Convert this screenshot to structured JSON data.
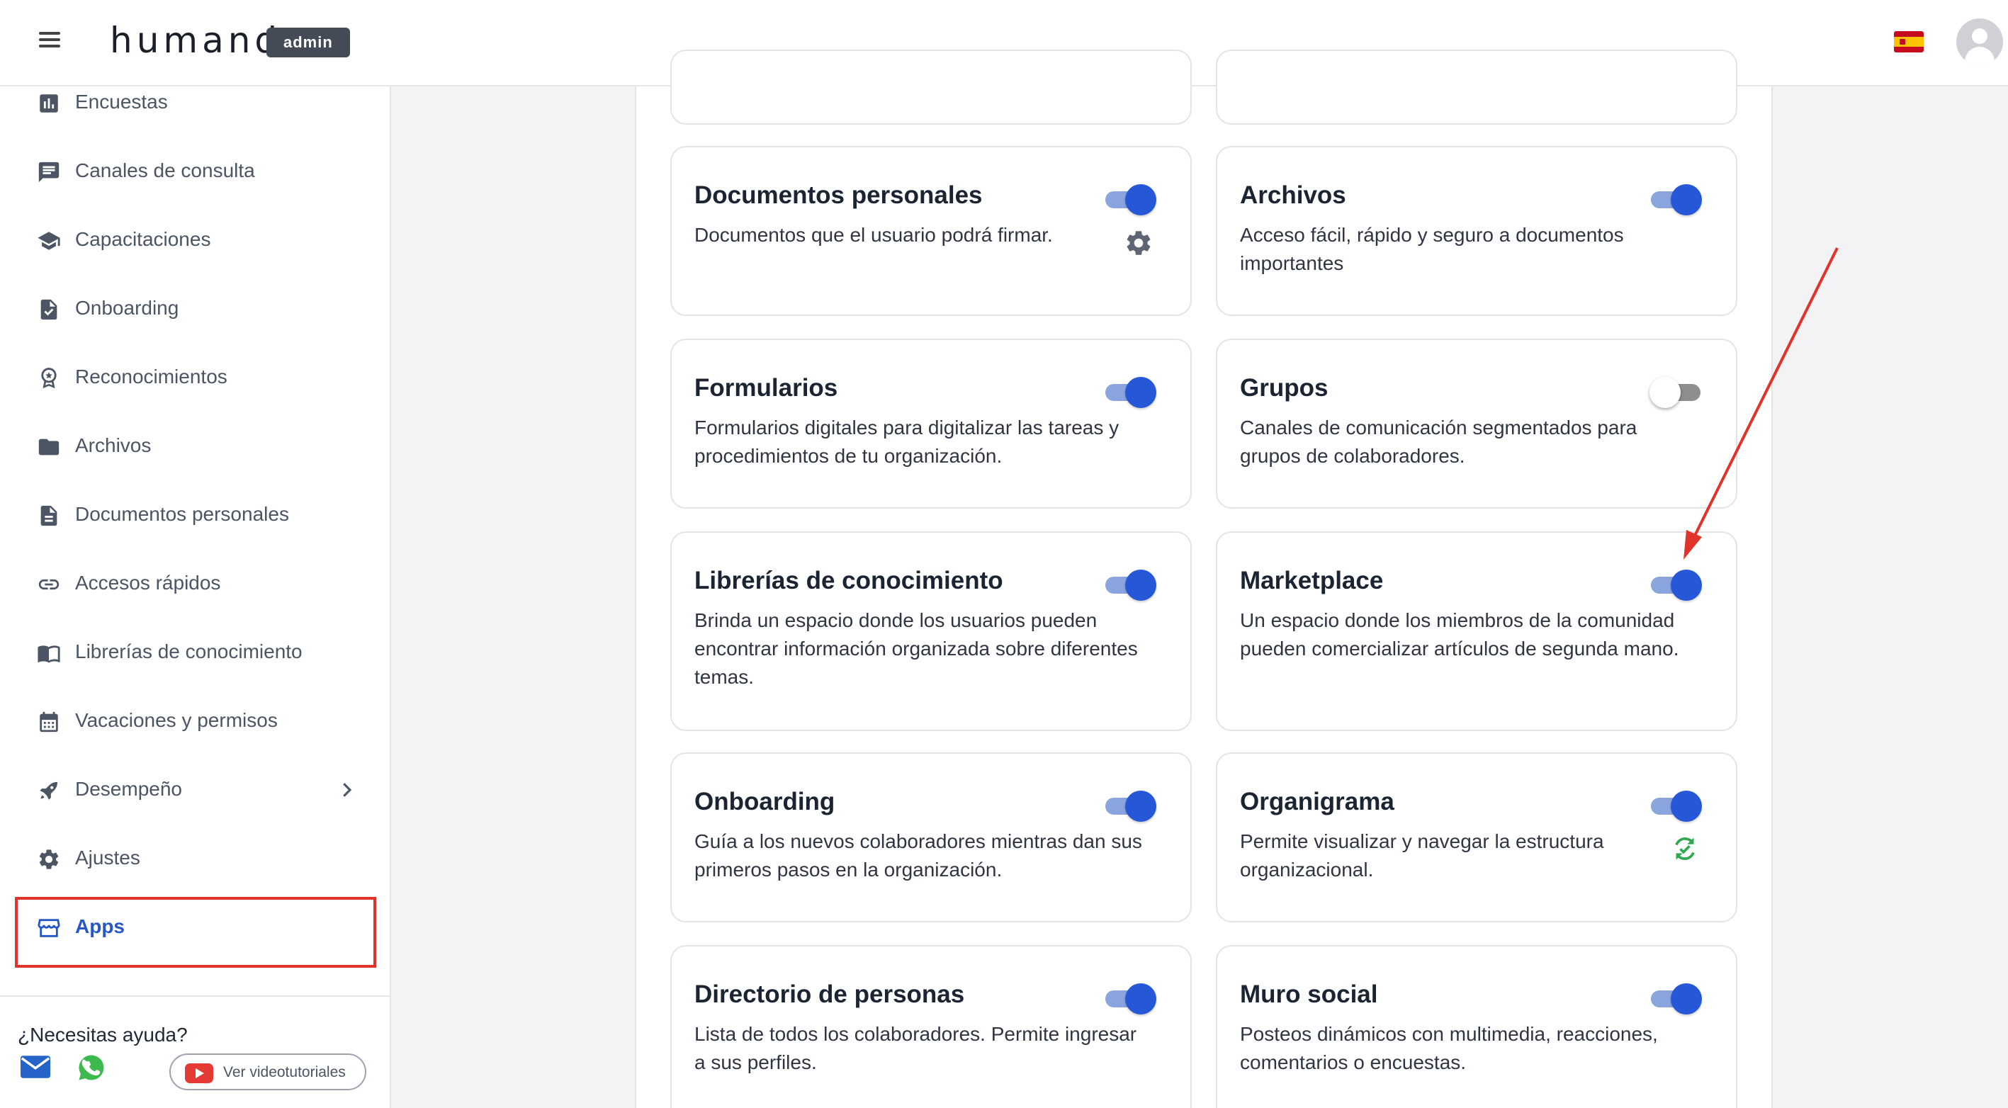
{
  "header": {
    "logo_text": "humand",
    "badge": "admin",
    "language_flag": "spain-flag",
    "avatar_icon": "user-avatar-icon"
  },
  "sidebar": {
    "items": [
      {
        "label": "Encuestas",
        "icon": "bar-chart-icon"
      },
      {
        "label": "Canales de consulta",
        "icon": "message-icon"
      },
      {
        "label": "Capacitaciones",
        "icon": "graduation-cap-icon"
      },
      {
        "label": "Onboarding",
        "icon": "document-check-icon"
      },
      {
        "label": "Reconocimientos",
        "icon": "award-icon"
      },
      {
        "label": "Archivos",
        "icon": "folder-icon"
      },
      {
        "label": "Documentos personales",
        "icon": "document-icon"
      },
      {
        "label": "Accesos rápidos",
        "icon": "link-icon"
      },
      {
        "label": "Librerías de conocimiento",
        "icon": "book-icon"
      },
      {
        "label": "Vacaciones y permisos",
        "icon": "calendar-icon"
      },
      {
        "label": "Desempeño",
        "icon": "rocket-icon"
      },
      {
        "label": "Ajustes",
        "icon": "gear-icon"
      },
      {
        "label": "Apps",
        "icon": "store-icon",
        "active": true
      }
    ],
    "help": {
      "title": "¿Necesitas ayuda?",
      "video_button": "Ver videotutoriales"
    }
  },
  "cards": [
    {
      "title": "Documentos personales",
      "description": "Documentos que el usuario podrá firmar.",
      "enabled": true
    },
    {
      "title": "Archivos",
      "description": "Acceso fácil, rápido y seguro a documentos importantes",
      "enabled": true
    },
    {
      "title": "Formularios",
      "description": "Formularios digitales para digitalizar las tareas y procedimientos de tu organización.",
      "enabled": true
    },
    {
      "title": "Grupos",
      "description": "Canales de comunicación segmentados para grupos de colaboradores.",
      "enabled": false
    },
    {
      "title": "Librerías de conocimiento",
      "description": "Brinda un espacio donde los usuarios pueden encontrar información organizada sobre diferentes temas.",
      "enabled": true
    },
    {
      "title": "Marketplace",
      "description": "Un espacio donde los miembros de la comunidad pueden comercializar artículos de segunda mano.",
      "enabled": true
    },
    {
      "title": "Onboarding",
      "description": "Guía a los nuevos colaboradores mientras dan sus primeros pasos en la organización.",
      "enabled": true
    },
    {
      "title": "Organigrama",
      "description": "Permite visualizar y navegar la estructura organizacional.",
      "enabled": true
    },
    {
      "title": "Directorio de personas",
      "description": "Lista de todos los colaboradores. Permite ingresar a sus perfiles.",
      "enabled": true
    },
    {
      "title": "Muro social",
      "description": "Posteos dinámicos con multimedia, reacciones, comentarios o encuestas.",
      "enabled": true
    }
  ],
  "colors": {
    "accent": "#2557d6",
    "highlight": "#e0342b",
    "sync_icon": "#2fa84f"
  }
}
